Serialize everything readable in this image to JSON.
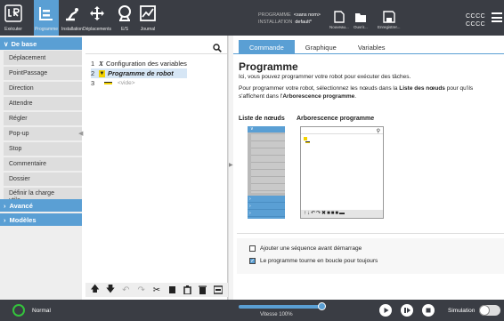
{
  "topbar": {
    "buttons": [
      {
        "label": "Exécuter"
      },
      {
        "label": "Programme"
      },
      {
        "label": "Installation"
      },
      {
        "label": "Déplacements"
      },
      {
        "label": "E/S"
      },
      {
        "label": "Journal"
      }
    ],
    "program_label": "PROGRAMME",
    "program_value": "<sans nom>",
    "installation_label": "INSTALLATION",
    "installation_value": "default*",
    "file_buttons": [
      {
        "label": "Nouveau..."
      },
      {
        "label": "Ouvrir..."
      },
      {
        "label": "Enregistrer..."
      }
    ],
    "user_line1": "CCCC",
    "user_line2": "CCCC"
  },
  "nav": {
    "sections": [
      {
        "label": "De base"
      },
      {
        "label": "Avancé"
      },
      {
        "label": "Modèles"
      }
    ],
    "items": [
      {
        "label": "Déplacement"
      },
      {
        "label": "PointPassage"
      },
      {
        "label": "Direction"
      },
      {
        "label": "Attendre"
      },
      {
        "label": "Régler"
      },
      {
        "label": "Pop-up"
      },
      {
        "label": "Stop"
      },
      {
        "label": "Commentaire"
      },
      {
        "label": "Dossier"
      },
      {
        "label": "Définir la charge utile"
      }
    ]
  },
  "tree": {
    "lines": [
      {
        "num": "1",
        "text": "Configuration des variables"
      },
      {
        "num": "2",
        "text": "Programme de robot"
      },
      {
        "num": "3",
        "text": "<vide>"
      }
    ]
  },
  "tabs": [
    {
      "label": "Commande"
    },
    {
      "label": "Graphique"
    },
    {
      "label": "Variables"
    }
  ],
  "panel": {
    "title": "Programme",
    "desc1": "Ici, vous pouvez programmer votre robot pour exécuter des tâches.",
    "desc2_a": "Pour programmer votre robot, sélectionnez les nœuds dans la ",
    "desc2_b": "Liste des nœuds",
    "desc2_c": " pour qu'ils s'affichent dans l'",
    "desc2_d": "Arborescence programme",
    "desc2_e": ".",
    "list_label": "Liste de nœuds",
    "tree_label": "Arborescence programme",
    "cb1": "Ajouter une séquence avant démarrage",
    "cb1_checked": false,
    "cb2": "Le programme tourne en boucle pour toujours",
    "cb2_checked": true
  },
  "bottom": {
    "status": "Normal",
    "speed": "Vitesse 100%",
    "speed_fraction": 1.0,
    "simulation_label": "Simulation"
  }
}
